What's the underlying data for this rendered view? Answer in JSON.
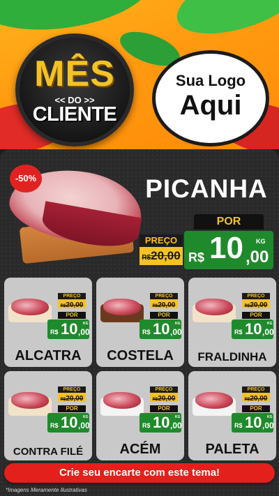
{
  "header": {
    "badge": {
      "line1": "MÊS",
      "line2": "<< DO >>",
      "line3": "CLIENTE"
    },
    "logo": {
      "line1": "Sua Logo",
      "line2": "Aqui"
    }
  },
  "hero": {
    "discount": "-50%",
    "name": "PICANHA",
    "old_label": "PREÇO",
    "old_currency": "R$",
    "old_value": "20,00",
    "new_label": "POR",
    "new_currency": "R$",
    "new_int": "10",
    "new_dec": ",00",
    "unit": "KG"
  },
  "products": [
    {
      "name": "ALCATRA",
      "old_label": "PREÇO",
      "old_currency": "R$",
      "old_value": "20,00",
      "new_label": "POR",
      "new_currency": "R$",
      "new_int": "10",
      "new_dec": ",00",
      "unit": "KG"
    },
    {
      "name": "COSTELA",
      "old_label": "PREÇO",
      "old_currency": "R$",
      "old_value": "20,00",
      "new_label": "POR",
      "new_currency": "R$",
      "new_int": "10",
      "new_dec": ",00",
      "unit": "KG"
    },
    {
      "name": "FRALDINHA",
      "old_label": "PREÇO",
      "old_currency": "R$",
      "old_value": "20,00",
      "new_label": "POR",
      "new_currency": "R$",
      "new_int": "10",
      "new_dec": ",00",
      "unit": "KG"
    },
    {
      "name": "CONTRA FILÉ",
      "old_label": "PREÇO",
      "old_currency": "R$",
      "old_value": "20,00",
      "new_label": "POR",
      "new_currency": "R$",
      "new_int": "10",
      "new_dec": ",00",
      "unit": "KG"
    },
    {
      "name": "ACÉM",
      "old_label": "PREÇO",
      "old_currency": "R$",
      "old_value": "20,00",
      "new_label": "POR",
      "new_currency": "R$",
      "new_int": "10",
      "new_dec": ",00",
      "unit": "KG"
    },
    {
      "name": "PALETA",
      "old_label": "PREÇO",
      "old_currency": "R$",
      "old_value": "20,00",
      "new_label": "POR",
      "new_currency": "R$",
      "new_int": "10",
      "new_dec": ",00",
      "unit": "KG"
    }
  ],
  "footer": {
    "cta": "Crie seu encarte com este tema!",
    "disclaimer": "*Imagens Meramente Ilustrativas"
  },
  "colors": {
    "header_orange": "#ff9a10",
    "price_green": "#1f8a2b",
    "price_yellow": "#f3c227",
    "cta_red": "#e3201b",
    "panel_dark": "#2a2a2a"
  }
}
